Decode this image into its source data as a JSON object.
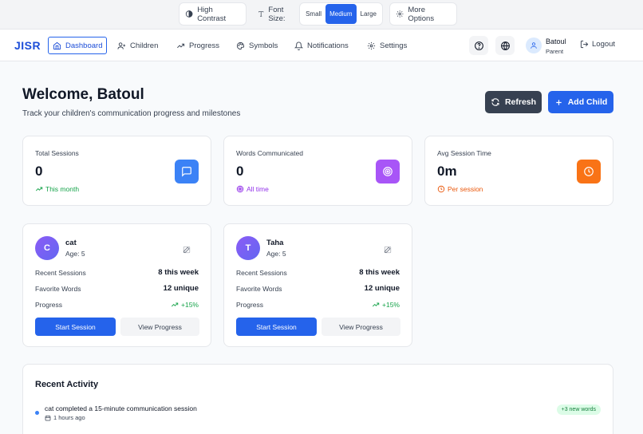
{
  "a11y": {
    "high_contrast": "High Contrast",
    "font_size_label": "Font Size:",
    "font_sizes": [
      "Small",
      "Medium",
      "Large"
    ],
    "more_options": "More Options"
  },
  "nav": {
    "logo": "JISR",
    "items": [
      {
        "label": "Dashboard",
        "icon": "home-icon"
      },
      {
        "label": "Children",
        "icon": "user-plus-icon"
      },
      {
        "label": "Progress",
        "icon": "trending-up-icon"
      },
      {
        "label": "Symbols",
        "icon": "palette-icon"
      },
      {
        "label": "Notifications",
        "icon": "bell-icon"
      },
      {
        "label": "Settings",
        "icon": "gear-icon"
      }
    ],
    "user_name": "Batoul",
    "user_role": "Parent",
    "logout": "Logout"
  },
  "header": {
    "welcome": "Welcome, Batoul",
    "subtitle": "Track your children's communication progress and milestones",
    "refresh": "Refresh",
    "add_child": "Add Child"
  },
  "stats": [
    {
      "label": "Total Sessions",
      "value": "0",
      "sub": "This month",
      "color": "#16a34a",
      "icon_bg": "#3b82f6",
      "icon": "message-square-icon"
    },
    {
      "label": "Words Communicated",
      "value": "0",
      "sub": "All time",
      "color": "#9333ea",
      "icon_bg": "#a855f7",
      "icon": "target-icon"
    },
    {
      "label": "Avg Session Time",
      "value": "0m",
      "sub": "Per session",
      "color": "#ea580c",
      "icon_bg": "#f97316",
      "icon": "clock-icon"
    }
  ],
  "children": [
    {
      "initial": "C",
      "name": "cat",
      "age": "Age: 5",
      "sessions_label": "Recent Sessions",
      "sessions": "8 this week",
      "words_label": "Favorite Words",
      "words": "12 unique",
      "progress_label": "Progress",
      "progress": "+15%",
      "start": "Start Session",
      "view": "View Progress"
    },
    {
      "initial": "T",
      "name": "Taha",
      "age": "Age: 5",
      "sessions_label": "Recent Sessions",
      "sessions": "8 this week",
      "words_label": "Favorite Words",
      "words": "12 unique",
      "progress_label": "Progress",
      "progress": "+15%",
      "start": "Start Session",
      "view": "View Progress"
    }
  ],
  "activity": {
    "title": "Recent Activity",
    "items": [
      {
        "text": "cat completed a 15-minute communication session",
        "time": "1 hours ago",
        "badge": "+3 new words"
      }
    ]
  }
}
